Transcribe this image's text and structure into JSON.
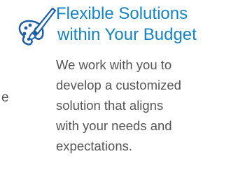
{
  "feature": {
    "icon": "paint-palette-brush-icon",
    "title_lines": [
      "Flexible Solutions",
      "within Your Budget"
    ],
    "description_lines": [
      "We work with you to",
      "develop a customized",
      "solution that aligns",
      "with your needs and",
      "expectations."
    ],
    "stray_text": "e",
    "colors": {
      "title": "#1583c6",
      "body_text": "#555555",
      "icon_stroke": "#1e5fa8",
      "icon_fill": "#ffffff"
    }
  }
}
